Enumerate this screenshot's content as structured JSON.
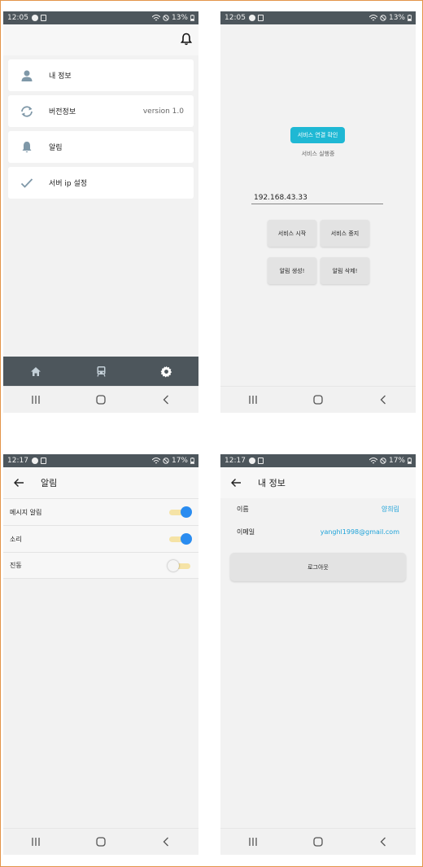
{
  "colors": {
    "statusbar": "#4d565c",
    "tabbar": "#4d565c",
    "accent_cyan": "#1fb8d4",
    "switch_on": "#2a8cf0",
    "switch_track": "#f5e3a6",
    "link": "#1fa3d9",
    "frame_border": "#e3954a"
  },
  "screens": {
    "settings": {
      "status": {
        "time": "12:05",
        "battery": "13%"
      },
      "header": {
        "icon": "bell-icon"
      },
      "items": [
        {
          "label": "내 정보",
          "icon": "person-icon",
          "value": ""
        },
        {
          "label": "버전정보",
          "icon": "sync-icon",
          "value": "version 1.0"
        },
        {
          "label": "알림",
          "icon": "bell-icon",
          "value": ""
        },
        {
          "label": "서버 ip 설정",
          "icon": "check-icon",
          "value": ""
        }
      ],
      "tabs": [
        {
          "icon": "home-icon"
        },
        {
          "icon": "train-icon"
        },
        {
          "icon": "gear-icon"
        }
      ]
    },
    "service": {
      "status": {
        "time": "12:05",
        "battery": "13%"
      },
      "check_button": "서비스 연결 확인",
      "service_status": "서비스 실행중",
      "ip_value": "192.168.43.33",
      "buttons": {
        "start": "서비스 시작",
        "stop": "서비스 중지",
        "create": "알림 생성!",
        "delete": "알림 삭제!"
      }
    },
    "notifications": {
      "status": {
        "time": "12:17",
        "battery": "17%"
      },
      "title": "알림",
      "toggles": [
        {
          "label": "메시지 알림",
          "on": true
        },
        {
          "label": "소리",
          "on": true
        },
        {
          "label": "진동",
          "on": false
        }
      ]
    },
    "profile": {
      "status": {
        "time": "12:17",
        "battery": "17%"
      },
      "title": "내 정보",
      "name_label": "이름",
      "name_value": "양희림",
      "email_label": "이메일",
      "email_value": "yanghl1998@gmail.com",
      "logout": "로그아웃"
    }
  }
}
